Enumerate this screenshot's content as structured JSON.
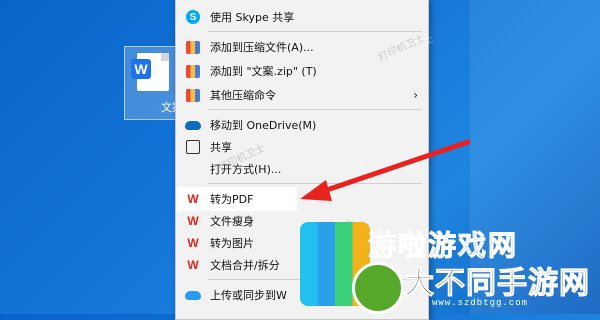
{
  "desktop": {
    "file_label": "文案",
    "file_badge": "W"
  },
  "menu": {
    "items": [
      {
        "label": "使用 Skype 共享",
        "icon": "skype-icon"
      },
      {
        "label": "添加到压缩文件(A)...",
        "icon": "zip-icon"
      },
      {
        "label": "添加到 \"文案.zip\" (T)",
        "icon": "zip-icon"
      },
      {
        "label": "其他压缩命令",
        "icon": "zip-icon",
        "submenu_arrow": "›"
      },
      {
        "label": "移动到 OneDrive(M)",
        "icon": "onedrive-icon"
      },
      {
        "label": "共享",
        "icon": "share-icon"
      },
      {
        "label": "打开方式(H)...",
        "icon": ""
      },
      {
        "label": "转为PDF",
        "icon": "wps-icon",
        "highlighted": true
      },
      {
        "label": "文件瘦身",
        "icon": "wps-icon"
      },
      {
        "label": "转为图片",
        "icon": "wps-icon"
      },
      {
        "label": "文档合并/拆分",
        "icon": "wps-icon"
      },
      {
        "label": "上传或同步到W",
        "icon": "cloud-upload-icon"
      }
    ]
  },
  "watermark_text": "打印机卫士",
  "banner": {
    "top_text": "游啦游戏网",
    "main_text": "大不同手游网",
    "url": "www.szdbtgg.com"
  },
  "colors": {
    "arrow": "#e8231f",
    "wps_red": "#e0261d",
    "desktop_blue": "#1577d8"
  }
}
